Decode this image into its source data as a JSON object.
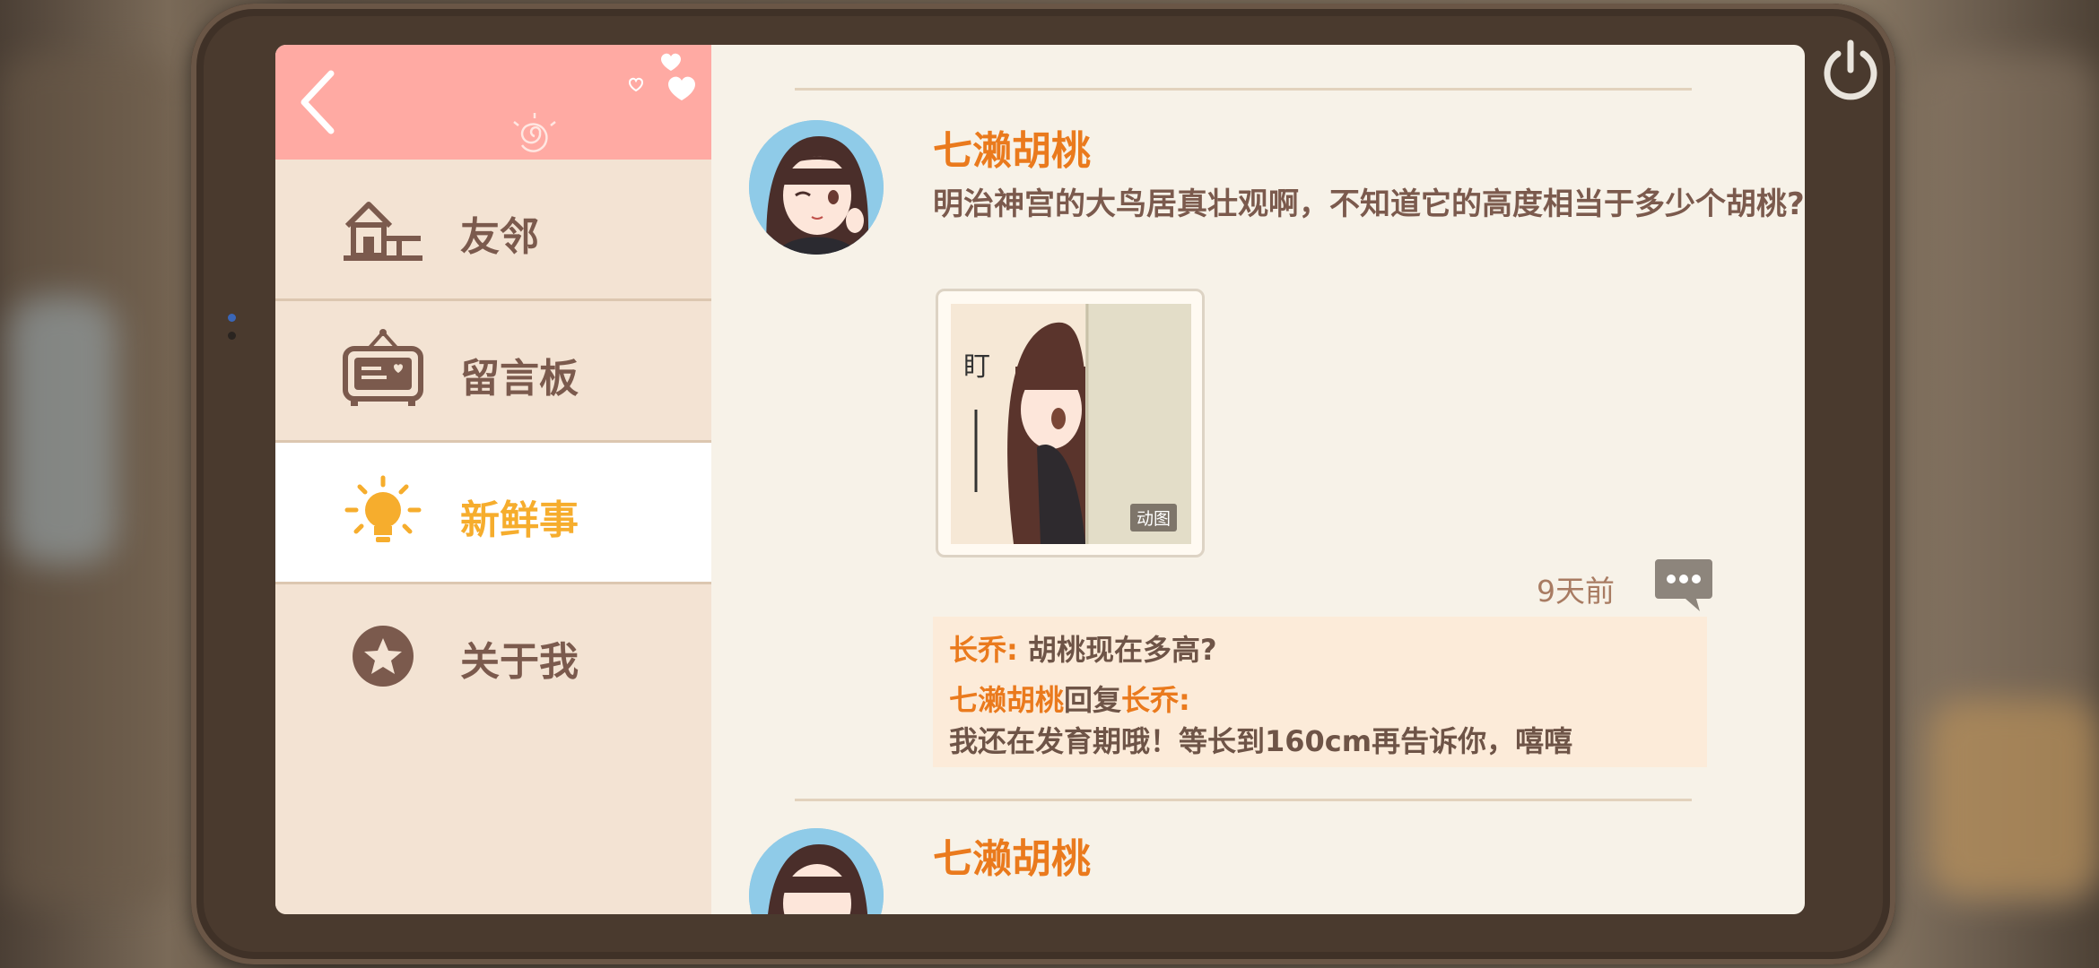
{
  "sidebar": {
    "items": [
      {
        "label": "友邻",
        "icon": "house-icon",
        "active": false
      },
      {
        "label": "留言板",
        "icon": "message-board-icon",
        "active": false
      },
      {
        "label": "新鲜事",
        "icon": "lightbulb-icon",
        "active": true
      },
      {
        "label": "关于我",
        "icon": "star-circle-icon",
        "active": false
      }
    ]
  },
  "feed": {
    "posts": [
      {
        "author": "七濑胡桃",
        "text": "明治神宫的大鸟居真壮观啊，不知道它的高度相当于多少个胡桃?",
        "image_caption": "盯",
        "image_badge": "动图",
        "time": "9天前",
        "comments": [
          {
            "name": "长乔",
            "separator": ": ",
            "text": "胡桃现在多高?"
          },
          {
            "name": "七濑胡桃",
            "reply_word": "回复",
            "reply_to": "长乔",
            "separator": ":",
            "text": "我还在发育期哦！等长到160cm再告诉你，嘻嘻"
          }
        ]
      },
      {
        "author": "七濑胡桃"
      }
    ]
  },
  "colors": {
    "accent_orange": "#ea7a1d",
    "active_yellow": "#f6ad2d",
    "header_pink": "#ffaaa3",
    "text_brown": "#7b5a4d"
  }
}
